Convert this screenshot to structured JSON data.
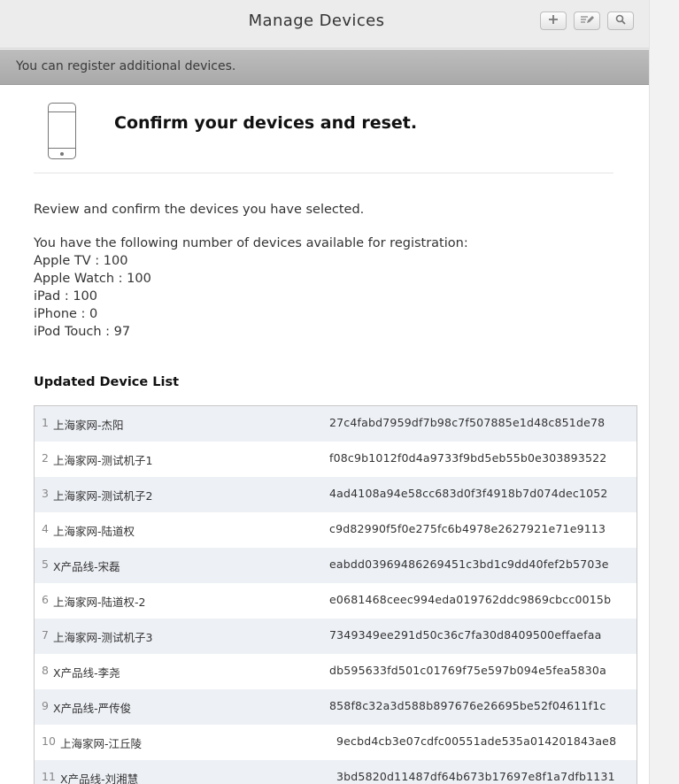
{
  "window": {
    "title": "Manage Devices",
    "toolbar": {
      "add_icon": "plus-icon",
      "edit_icon": "edit-icon",
      "search_icon": "search-icon"
    }
  },
  "info_bar": {
    "text": "You can register additional devices."
  },
  "content": {
    "device_icon": "iphone-icon",
    "heading": "Confirm your devices and reset.",
    "review_text": "Review and confirm the devices you have selected.",
    "available_intro": "You have the following number of devices available for registration:",
    "available": [
      {
        "text": "Apple TV : 100"
      },
      {
        "text": "Apple Watch : 100"
      },
      {
        "text": "iPad : 100"
      },
      {
        "text": "iPhone : 0"
      },
      {
        "text": "iPod Touch : 97"
      }
    ],
    "list_title": "Updated Device List",
    "devices": [
      {
        "num": "1",
        "name": "上海家网-杰阳",
        "udid": "27c4fabd7959df7b98c7f507885e1d48c851de78"
      },
      {
        "num": "2",
        "name": "上海家网-测试机子1",
        "udid": "f08c9b1012f0d4a9733f9bd5eb55b0e303893522"
      },
      {
        "num": "3",
        "name": "上海家网-测试机子2",
        "udid": "4ad4108a94e58cc683d0f3f4918b7d074dec1052"
      },
      {
        "num": "4",
        "name": "上海家网-陆道权",
        "udid": "c9d82990f5f0e275fc6b4978e2627921e71e9113"
      },
      {
        "num": "5",
        "name": "X产品线-宋磊",
        "udid": "eabdd03969486269451c3bd1c9dd40fef2b5703e"
      },
      {
        "num": "6",
        "name": "上海家网-陆道权-2",
        "udid": "e0681468ceec994eda019762ddc9869cbcc0015b"
      },
      {
        "num": "7",
        "name": "上海家网-测试机子3",
        "udid": "7349349ee291d50c36c7fa30d8409500effaefaa"
      },
      {
        "num": "8",
        "name": "X产品线-李尧",
        "udid": "db595633fd501c01769f75e597b094e5fea5830a"
      },
      {
        "num": "9",
        "name": "X产品线-严传俊",
        "udid": "858f8c32a3d588b897676e26695be52f04611f1c"
      },
      {
        "num": "10",
        "name": "上海家网-江丘陵",
        "udid": "9ecbd4cb3e07cdfc00551ade535a014201843ae8"
      },
      {
        "num": "11",
        "name": "X产品线-刘湘慧",
        "udid": "3bd5820d11487df64b673b17697e8f1a7dfb1131"
      }
    ]
  }
}
